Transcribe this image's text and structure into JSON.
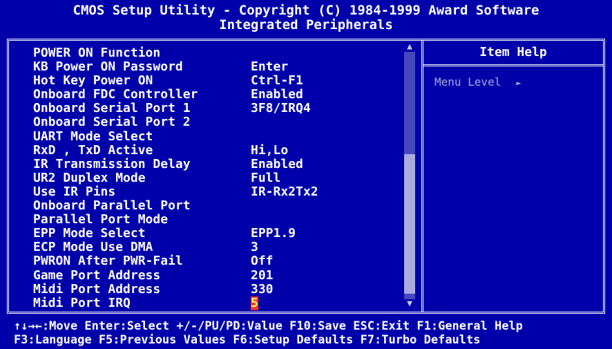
{
  "header": {
    "line1": "CMOS Setup Utility - Copyright (C) 1984-1999 Award Software",
    "line2": "Integrated Peripherals"
  },
  "settings": [
    {
      "label": "POWER ON Function",
      "value": ""
    },
    {
      "label": "KB Power ON Password",
      "value": "Enter"
    },
    {
      "label": "Hot Key Power ON",
      "value": "Ctrl-F1"
    },
    {
      "label": "Onboard FDC Controller",
      "value": "Enabled"
    },
    {
      "label": "Onboard Serial Port 1",
      "value": "3F8/IRQ4"
    },
    {
      "label": "Onboard Serial Port 2",
      "value": ""
    },
    {
      "label": "UART Mode Select",
      "value": ""
    },
    {
      "label": "RxD , TxD Active",
      "value": "Hi,Lo"
    },
    {
      "label": "IR Transmission Delay",
      "value": "Enabled"
    },
    {
      "label": "UR2 Duplex Mode",
      "value": "Full"
    },
    {
      "label": "Use IR Pins",
      "value": "IR-Rx2Tx2"
    },
    {
      "label": "Onboard Parallel Port",
      "value": ""
    },
    {
      "label": "Parallel Port Mode",
      "value": ""
    },
    {
      "label": "EPP Mode Select",
      "value": "EPP1.9"
    },
    {
      "label": "ECP Mode Use DMA",
      "value": "3"
    },
    {
      "label": "PWRON After PWR-Fail",
      "value": "Off"
    },
    {
      "label": "Game Port Address",
      "value": "201"
    },
    {
      "label": "Midi Port Address",
      "value": "330"
    },
    {
      "label": "Midi Port IRQ",
      "value": "5"
    }
  ],
  "selected_index": 18,
  "scrollbar": {
    "up_arrow": "▲",
    "down_arrow": "▼"
  },
  "help": {
    "title": "Item Help",
    "menu_level_label": "Menu Level",
    "menu_level_marker": "►"
  },
  "footer": {
    "line1": "↑↓→←:Move  Enter:Select  +/-/PU/PD:Value  F10:Save  ESC:Exit  F1:General Help",
    "line2": "F3:Language F5:Previous Values F6:Setup Defaults F7:Turbo Defaults"
  },
  "colors": {
    "background": "#0000aa",
    "text": "#ffffff",
    "selected_bg": "#ff3030",
    "selected_text": "#ffff55"
  }
}
